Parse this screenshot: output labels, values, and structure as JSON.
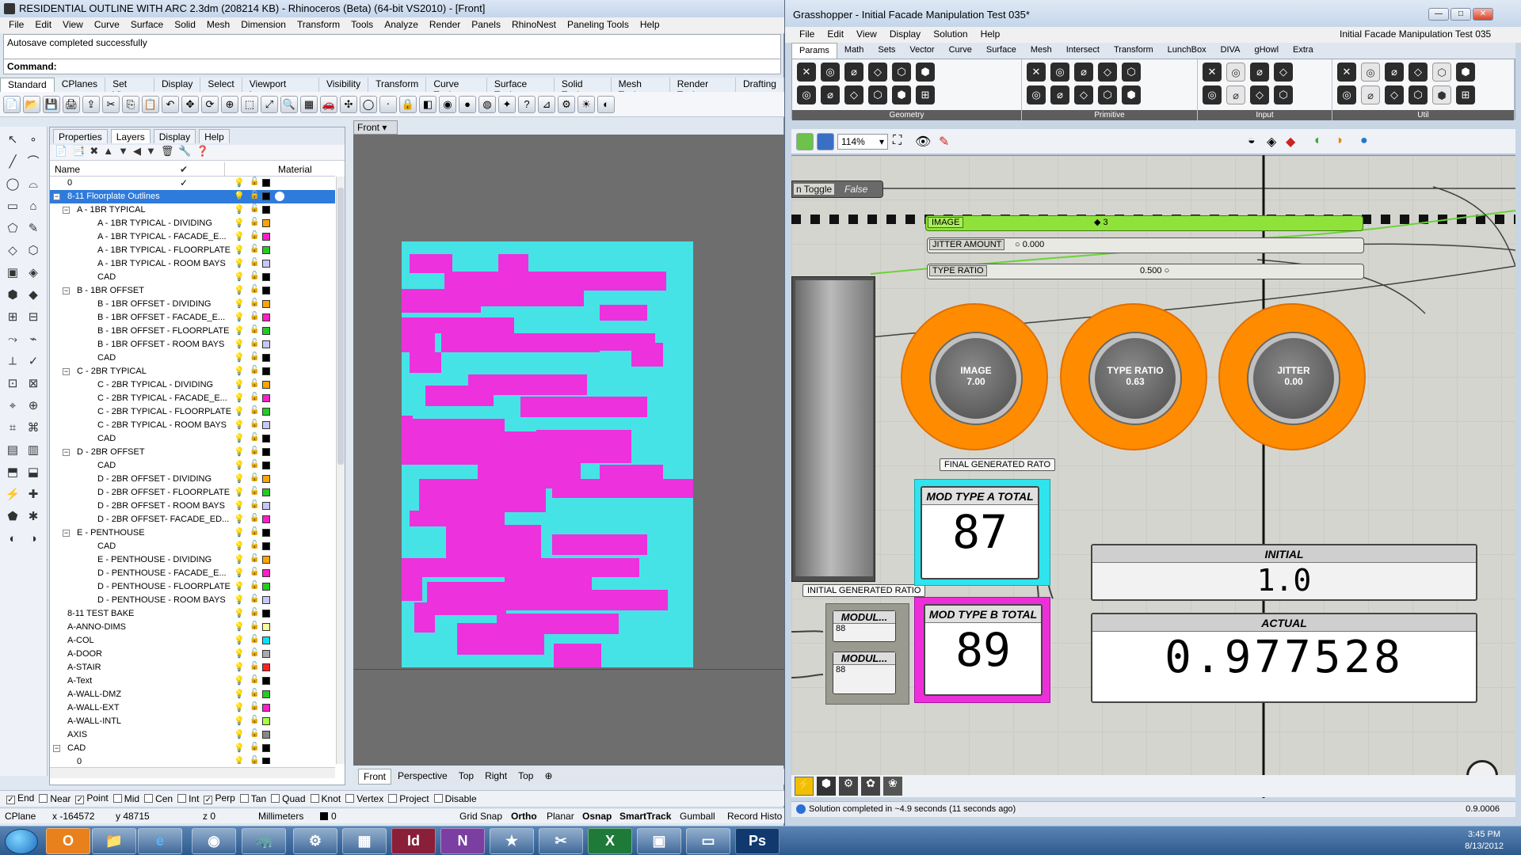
{
  "rhino": {
    "title": "RESIDENTIAL OUTLINE WITH ARC 2.3dm (208214 KB) - Rhinoceros (Beta) (64-bit VS2010) - [Front]",
    "menu": [
      "File",
      "Edit",
      "View",
      "Curve",
      "Surface",
      "Solid",
      "Mesh",
      "Dimension",
      "Transform",
      "Tools",
      "Analyze",
      "Render",
      "Panels",
      "RhinoNest",
      "Paneling Tools",
      "Help"
    ],
    "command_history": "Autosave completed successfully",
    "command_prompt": "Command:",
    "toolbar_tabs": [
      "Standard",
      "CPlanes",
      "Set View",
      "Display",
      "Select",
      "Viewport Layout",
      "Visibility",
      "Transform",
      "Curve Tools",
      "Surface Tools",
      "Solid Tools",
      "Mesh Tools",
      "Render Tools",
      "Drafting"
    ],
    "panel_tabs": [
      "Properties",
      "Layers",
      "Display",
      "Help"
    ],
    "layer_headers": {
      "name": "Name",
      "material": "Material"
    },
    "layers": [
      {
        "name": "0",
        "indent": 0,
        "color": "#000000",
        "check": "✓"
      },
      {
        "name": "8-11 Floorplate Outlines",
        "indent": 0,
        "color": "#000000",
        "toggle": "−",
        "selected": true
      },
      {
        "name": "A - 1BR TYPICAL",
        "indent": 1,
        "color": "#000000",
        "toggle": "−"
      },
      {
        "name": "A - 1BR TYPICAL - DIVIDING",
        "indent": 2,
        "color": "#ffa500"
      },
      {
        "name": "A - 1BR TYPICAL - FACADE_E...",
        "indent": 2,
        "color": "#ff1ec8"
      },
      {
        "name": "A - 1BR TYPICAL - FLOORPLATE",
        "indent": 2,
        "color": "#22cc22"
      },
      {
        "name": "A - 1BR TYPICAL - ROOM BAYS",
        "indent": 2,
        "color": "#c8c8ff"
      },
      {
        "name": "CAD",
        "indent": 2,
        "color": "#000000",
        "on": true
      },
      {
        "name": "B - 1BR OFFSET",
        "indent": 1,
        "color": "#000000",
        "toggle": "−"
      },
      {
        "name": "B - 1BR OFFSET - DIVIDING",
        "indent": 2,
        "color": "#ffa500"
      },
      {
        "name": "B - 1BR OFFSET - FACADE_E...",
        "indent": 2,
        "color": "#ff1ec8"
      },
      {
        "name": "B - 1BR OFFSET - FLOORPLATE",
        "indent": 2,
        "color": "#22cc22"
      },
      {
        "name": "B - 1BR OFFSET - ROOM BAYS",
        "indent": 2,
        "color": "#c8c8ff"
      },
      {
        "name": "CAD",
        "indent": 2,
        "color": "#000000",
        "on": true
      },
      {
        "name": "C - 2BR TYPICAL",
        "indent": 1,
        "color": "#000000",
        "toggle": "−"
      },
      {
        "name": "C - 2BR TYPICAL - DIVIDING",
        "indent": 2,
        "color": "#ffa500"
      },
      {
        "name": "C - 2BR TYPICAL - FACADE_E...",
        "indent": 2,
        "color": "#ff1ec8"
      },
      {
        "name": "C - 2BR TYPICAL - FLOORPLATE",
        "indent": 2,
        "color": "#22cc22"
      },
      {
        "name": "C - 2BR TYPICAL - ROOM BAYS",
        "indent": 2,
        "color": "#c8c8ff"
      },
      {
        "name": "CAD",
        "indent": 2,
        "color": "#000000",
        "on": true
      },
      {
        "name": "D - 2BR OFFSET",
        "indent": 1,
        "color": "#000000",
        "toggle": "−"
      },
      {
        "name": "CAD",
        "indent": 2,
        "color": "#000000",
        "on": true
      },
      {
        "name": "D - 2BR OFFSET - DIVIDING",
        "indent": 2,
        "color": "#ffa500"
      },
      {
        "name": "D - 2BR OFFSET - FLOORPLATE",
        "indent": 2,
        "color": "#22cc22"
      },
      {
        "name": "D - 2BR OFFSET - ROOM BAYS",
        "indent": 2,
        "color": "#c8c8ff"
      },
      {
        "name": "D - 2BR OFFSET- FACADE_ED...",
        "indent": 2,
        "color": "#ff1ec8"
      },
      {
        "name": "E - PENTHOUSE",
        "indent": 1,
        "color": "#000000",
        "toggle": "−"
      },
      {
        "name": "CAD",
        "indent": 2,
        "color": "#000000",
        "on": true
      },
      {
        "name": "E - PENTHOUSE - DIVIDING",
        "indent": 2,
        "color": "#ffa500"
      },
      {
        "name": "D - PENTHOUSE - FACADE_E...",
        "indent": 2,
        "color": "#ff1ec8"
      },
      {
        "name": "D - PENTHOUSE - FLOORPLATE",
        "indent": 2,
        "color": "#22cc22"
      },
      {
        "name": "D - PENTHOUSE - ROOM BAYS",
        "indent": 2,
        "color": "#c8c8ff"
      },
      {
        "name": "8-11 TEST BAKE",
        "indent": 0,
        "color": "#000000"
      },
      {
        "name": "A-ANNO-DIMS",
        "indent": 0,
        "color": "#ffff99"
      },
      {
        "name": "A-COL",
        "indent": 0,
        "color": "#00e5ff"
      },
      {
        "name": "A-DOOR",
        "indent": 0,
        "color": "#aaaaaa"
      },
      {
        "name": "A-STAIR",
        "indent": 0,
        "color": "#ff2222"
      },
      {
        "name": "A-Text",
        "indent": 0,
        "color": "#000000"
      },
      {
        "name": "A-WALL-DMZ",
        "indent": 0,
        "color": "#22cc22"
      },
      {
        "name": "A-WALL-EXT",
        "indent": 0,
        "color": "#ff1ec8"
      },
      {
        "name": "A-WALL-INTL",
        "indent": 0,
        "color": "#aaff44"
      },
      {
        "name": "AXIS",
        "indent": 0,
        "color": "#888888"
      },
      {
        "name": "CAD",
        "indent": 0,
        "color": "#000000",
        "toggle": "−"
      },
      {
        "name": "0",
        "indent": 1,
        "color": "#000000"
      }
    ],
    "viewport_label": "Front",
    "viewport_tabs": [
      "Front",
      "Perspective",
      "Top",
      "Right",
      "Top"
    ],
    "osnaps": [
      {
        "label": "End",
        "checked": true
      },
      {
        "label": "Near",
        "checked": false
      },
      {
        "label": "Point",
        "checked": true
      },
      {
        "label": "Mid",
        "checked": false
      },
      {
        "label": "Cen",
        "checked": false
      },
      {
        "label": "Int",
        "checked": false
      },
      {
        "label": "Perp",
        "checked": true
      },
      {
        "label": "Tan",
        "checked": false
      },
      {
        "label": "Quad",
        "checked": false
      },
      {
        "label": "Knot",
        "checked": false
      },
      {
        "label": "Vertex",
        "checked": false
      },
      {
        "label": "Project",
        "checked": false
      },
      {
        "label": "Disable",
        "checked": false
      }
    ],
    "status": {
      "cplane": "CPlane",
      "x": "x -164572",
      "y": "y 48715",
      "z": "z 0",
      "units": "Millimeters",
      "layer": "0",
      "grid_snap": "Grid Snap",
      "ortho": "Ortho",
      "planar": "Planar",
      "osnap": "Osnap",
      "smarttrack": "SmartTrack",
      "gumball": "Gumball",
      "record": "Record Histo"
    },
    "colors": {
      "cyan": "#46e3e6",
      "magenta": "#ed31dc"
    }
  },
  "grasshopper": {
    "title": "Grasshopper - Initial Facade Manipulation Test 035*",
    "document": "Initial Facade Manipulation Test 035",
    "menu": [
      "File",
      "Edit",
      "View",
      "Display",
      "Solution",
      "Help"
    ],
    "tabs": [
      "Params",
      "Math",
      "Sets",
      "Vector",
      "Curve",
      "Surface",
      "Mesh",
      "Intersect",
      "Transform",
      "LunchBox",
      "DIVA",
      "gHowl",
      "Extra"
    ],
    "ribbon_groups": [
      "Geometry",
      "Primitive",
      "Input",
      "Util"
    ],
    "zoom": "114%",
    "toggle_label": "n Toggle",
    "toggle_value": "False",
    "sliders": [
      {
        "label": "IMAGE",
        "value": "3"
      },
      {
        "label": "JITTER AMOUNT",
        "value": "0.000"
      },
      {
        "label": "TYPE RATIO",
        "value": "0.500"
      }
    ],
    "knobs": [
      {
        "label": "IMAGE",
        "value": "7.00"
      },
      {
        "label": "TYPE RATIO",
        "value": "0.63"
      },
      {
        "label": "JITTER",
        "value": "0.00"
      }
    ],
    "final_ratio_tag": "FINAL GENERATED RATO",
    "initial_ratio_tag": "INITIAL GENERATED RATIO",
    "mod_a": {
      "title": "MOD TYPE A TOTAL",
      "value": "87"
    },
    "mod_b": {
      "title": "MOD TYPE B TOTAL",
      "value": "89"
    },
    "modul": [
      {
        "label": "MODUL...",
        "value": "88"
      },
      {
        "label": "MODUL...",
        "value": "88"
      }
    ],
    "initial": {
      "title": "INITIAL",
      "value": "1.0"
    },
    "actual": {
      "title": "ACTUAL",
      "value": "0.977528"
    },
    "status": "Solution completed in ~4.9 seconds (11 seconds ago)",
    "version": "0.9.0006",
    "colors": {
      "slider_green": "#8fe23a",
      "knob_orange": "#ff8c00",
      "panel_cyan": "#2fe4ee",
      "panel_magenta": "#ee2fd9"
    }
  },
  "taskbar": {
    "time": "3:45 PM",
    "date": "8/13/2012"
  }
}
